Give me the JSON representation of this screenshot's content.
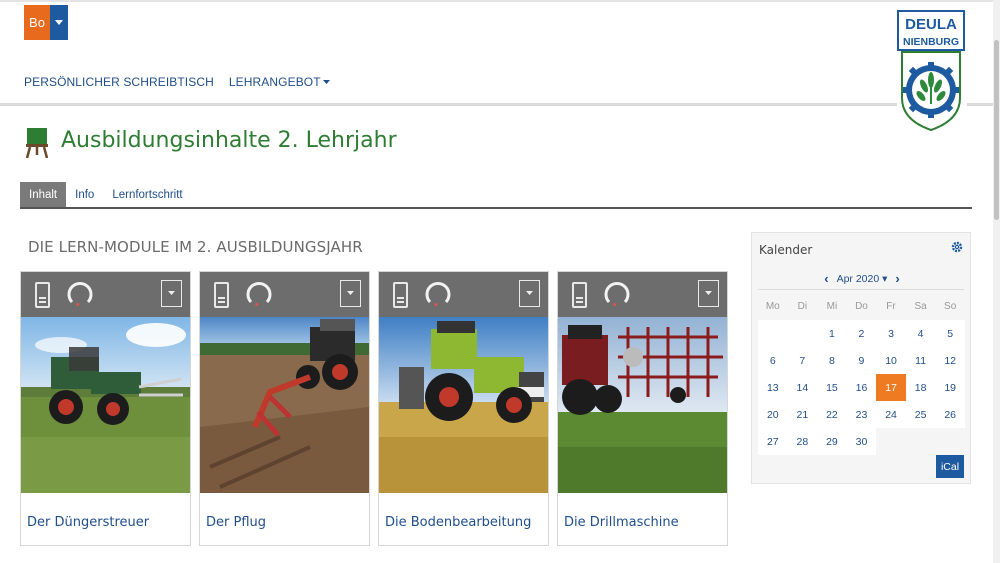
{
  "user": {
    "initials": "Bo"
  },
  "nav": {
    "items": [
      {
        "label": "PERSÖNLICHER SCHREIBTISCH"
      },
      {
        "label": "LEHRANGEBOT"
      }
    ]
  },
  "logo": {
    "line1": "DEULA",
    "line2": "NIENBURG"
  },
  "page": {
    "title": "Ausbildungsinhalte 2. Lehrjahr"
  },
  "tabs": [
    {
      "label": "Inhalt",
      "active": true
    },
    {
      "label": "Info",
      "active": false
    },
    {
      "label": "Lernfortschritt",
      "active": false
    }
  ],
  "section": {
    "title": "DIE LERN-MODULE IM 2. AUSBILDUNGSJAHR"
  },
  "modules": [
    {
      "name": "Der Düngerstreuer"
    },
    {
      "name": "Der Pflug"
    },
    {
      "name": "Die Bodenbearbeitung"
    },
    {
      "name": "Die Drillmaschine"
    }
  ],
  "calendar": {
    "title": "Kalender",
    "month": "Apr 2020",
    "weekdays": [
      "Mo",
      "Di",
      "Mi",
      "Do",
      "Fr",
      "Sa",
      "So"
    ],
    "weeks": [
      [
        "",
        "",
        "1",
        "2",
        "3",
        "4",
        "5"
      ],
      [
        "6",
        "7",
        "8",
        "9",
        "10",
        "11",
        "12"
      ],
      [
        "13",
        "14",
        "15",
        "16",
        "17",
        "18",
        "19"
      ],
      [
        "20",
        "21",
        "22",
        "23",
        "24",
        "25",
        "26"
      ],
      [
        "27",
        "28",
        "29",
        "30",
        "",
        "",
        ""
      ]
    ],
    "today": "17",
    "ical_label": "iCal"
  },
  "colors": {
    "brand_blue": "#1e5aa0",
    "link_blue": "#1f4e8a",
    "title_green": "#2d7d32",
    "accent_orange": "#e86a1d"
  }
}
